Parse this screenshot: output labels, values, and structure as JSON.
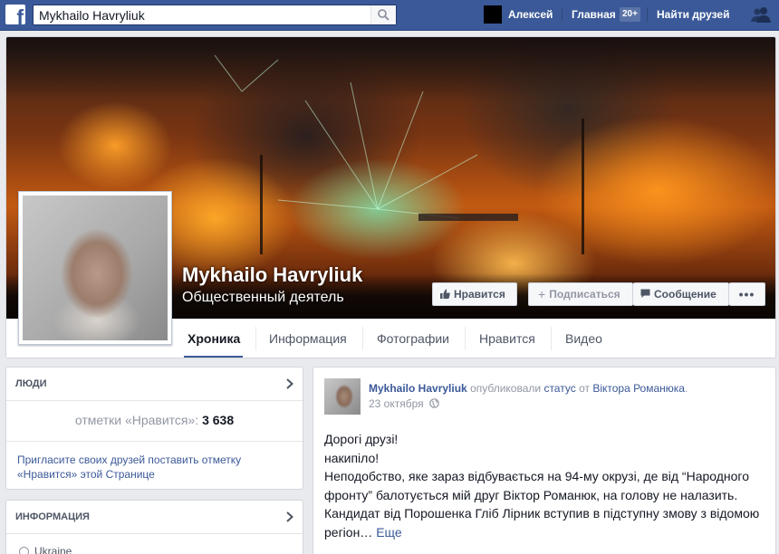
{
  "topbar": {
    "search_value": "Mykhailo Havryliuk",
    "user_name": "Алексей",
    "home_label": "Главная",
    "home_badge": "20+",
    "find_friends_label": "Найти друзей",
    "accent_color": "#3b5998"
  },
  "profile": {
    "name": "Mykhailo Havryliuk",
    "category": "Общественный деятель",
    "buttons": {
      "like": "Нравится",
      "subscribe": "Подписаться",
      "message": "Сообщение",
      "more": "•••"
    },
    "tabs": [
      "Хроника",
      "Информация",
      "Фотографии",
      "Нравится",
      "Видео"
    ],
    "active_tab": "Хроника"
  },
  "left": {
    "people_title": "Люди",
    "likes_label": "отметки «Нравится»:",
    "likes_count": "3 638",
    "invite_text": "Пригласите своих друзей поставить отметку «Нравится» этой Странице",
    "info_title": "Информация",
    "info_partial": "Ukraine"
  },
  "post": {
    "author": "Mykhailo Havryliuk",
    "published": "опубликовали",
    "status_link": "статус",
    "from": "от",
    "source": "Віктора Романюка",
    "date": "23 октября",
    "lines": [
      "Дорогі друзі!",
      "накипіло!",
      "Неподобство, яке зараз відбувається на 94-му окрузі, де від “Народного",
      "фронту” балотується мій друг Віктор Романюк, на голову не налазить.",
      "Кандидат від Порошенка Гліб Лірник вступив в підступну змову з відомою",
      "регіон…"
    ],
    "more_label": "Еще"
  }
}
